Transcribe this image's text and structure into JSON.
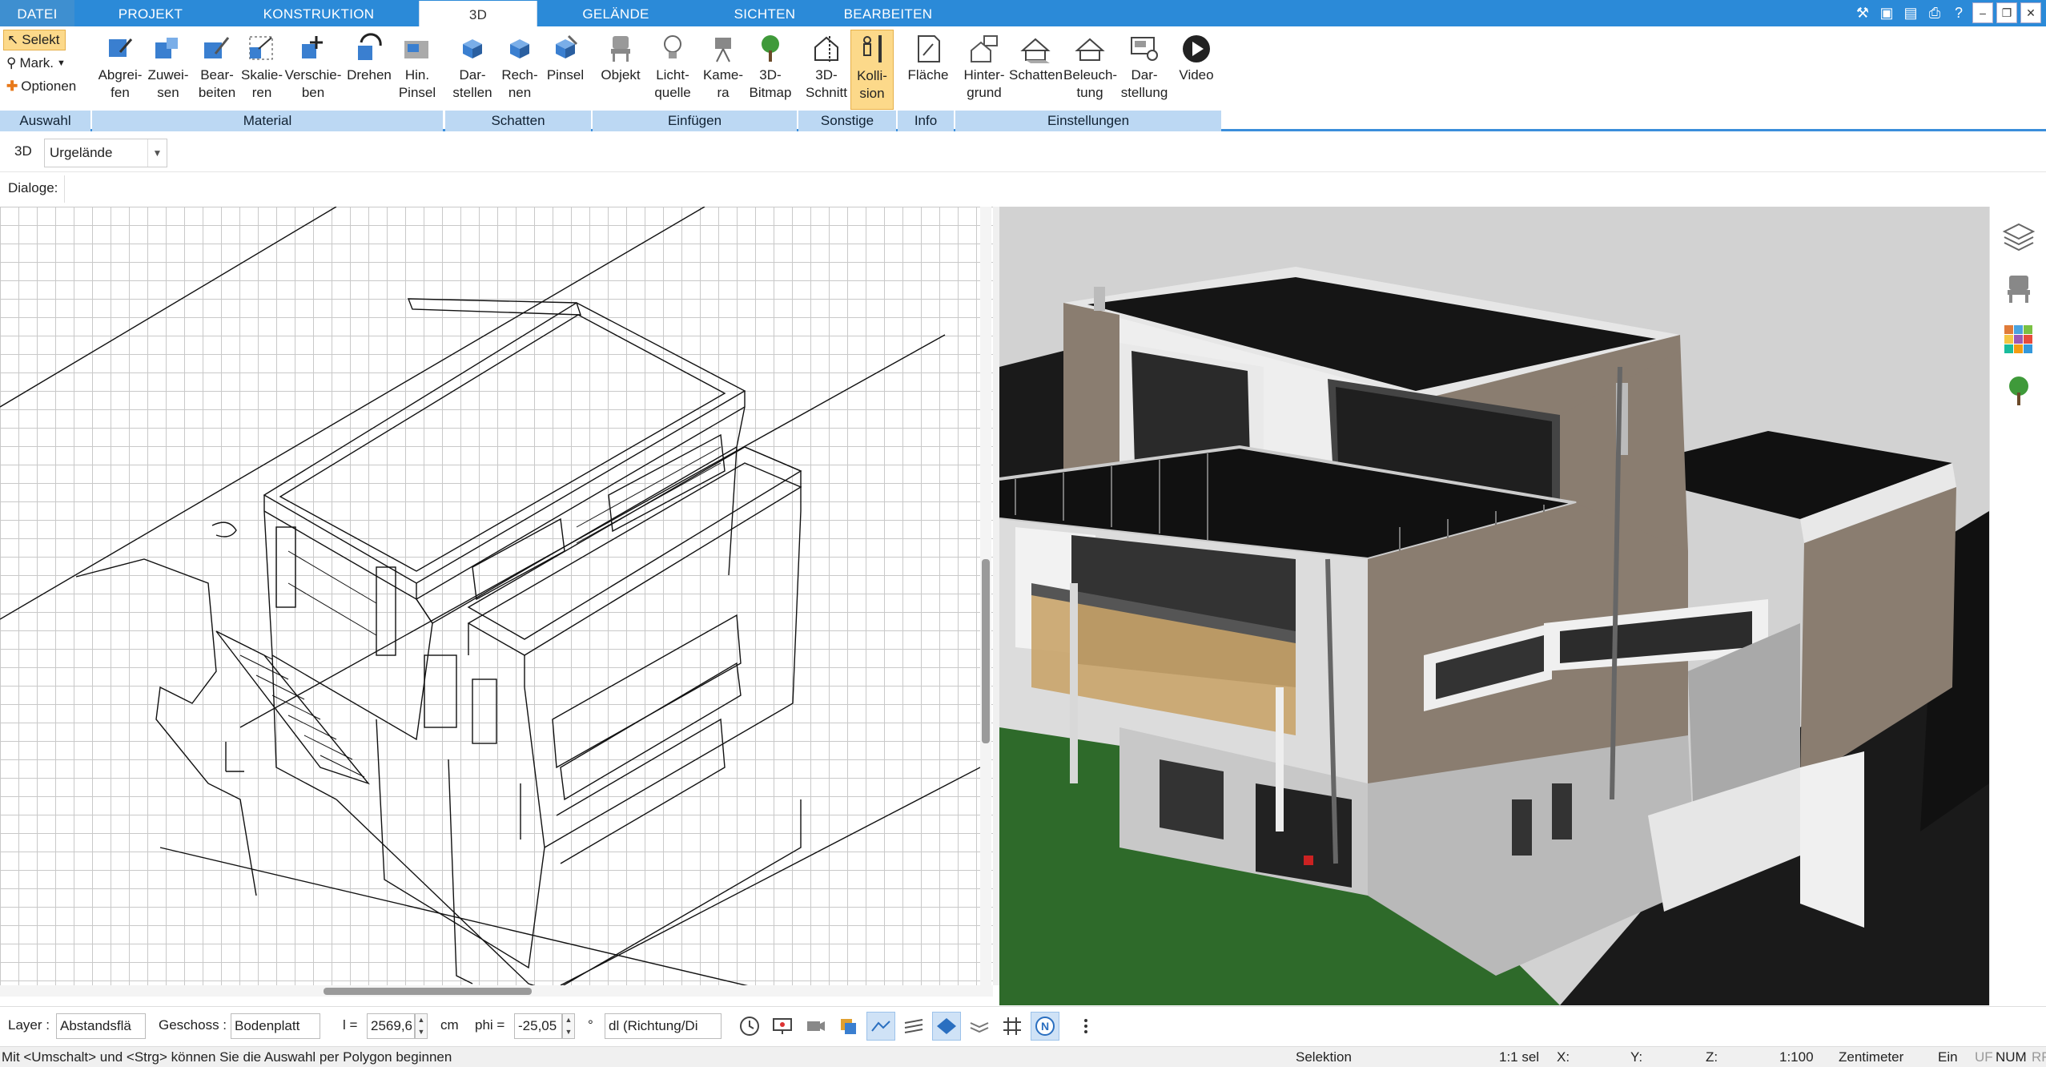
{
  "tabs": [
    {
      "label": "DATEI",
      "kind": "file"
    },
    {
      "label": "PROJEKT"
    },
    {
      "label": "KONSTRUKTION"
    },
    {
      "label": "3D",
      "active": true
    },
    {
      "label": "GELÄNDE"
    },
    {
      "label": "SICHTEN"
    },
    {
      "label": "BEARBEITEN"
    }
  ],
  "ribbon": {
    "selekt": "Selekt",
    "mark": "Mark.",
    "optionen": "Optionen",
    "buttons": [
      {
        "label": "Abgrei-\nfen",
        "icon": "eyedropper-icon"
      },
      {
        "label": "Zuwei-\nsen",
        "icon": "assign-material-icon"
      },
      {
        "label": "Bear-\nbeiten",
        "icon": "edit-material-icon"
      },
      {
        "label": "Skalie-\nren",
        "icon": "scale-icon"
      },
      {
        "label": "Verschie-\nben",
        "icon": "move-icon"
      },
      {
        "label": "Drehen",
        "icon": "rotate-icon"
      },
      {
        "label": "Hin.\nPinsel",
        "icon": "background-brush-icon"
      },
      {
        "label": "Dar-\nstellen",
        "icon": "shadow-display-icon"
      },
      {
        "label": "Rech-\nnen",
        "icon": "shadow-calc-icon"
      },
      {
        "label": "Pinsel",
        "icon": "shadow-brush-icon"
      },
      {
        "label": "Objekt",
        "icon": "chair-icon"
      },
      {
        "label": "Licht-\nquelle",
        "icon": "lightbulb-icon"
      },
      {
        "label": "Kame-\nra",
        "icon": "camera-icon"
      },
      {
        "label": "3D-\nBitmap",
        "icon": "tree-icon"
      },
      {
        "label": "3D-\nSchnitt",
        "icon": "section-icon"
      },
      {
        "label": "Kolli-\nsion",
        "icon": "collision-icon",
        "active": true
      },
      {
        "label": "Fläche",
        "icon": "area-icon"
      },
      {
        "label": "Hinter-\ngrund",
        "icon": "background-icon"
      },
      {
        "label": "Schatten",
        "icon": "shadow-house-icon"
      },
      {
        "label": "Beleuch-\ntung",
        "icon": "lighting-icon"
      },
      {
        "label": "Dar-\nstellung",
        "icon": "display-icon"
      },
      {
        "label": "Video",
        "icon": "video-play-icon"
      }
    ],
    "groups": [
      "Auswahl",
      "Material",
      "Schatten",
      "Einfügen",
      "Sonstige",
      "Info",
      "Einstellungen"
    ]
  },
  "toolbar": {
    "view_label": "3D",
    "view_value": "Urgelände",
    "dialoge": "Dialoge:"
  },
  "bottom": {
    "layer_label": "Layer :",
    "layer_value": "Abstandsflä",
    "geschoss_label": "Geschoss :",
    "geschoss_value": "Bodenplatt",
    "l_label": "l =",
    "l_value": "2569,6",
    "l_unit": "cm",
    "phi_label": "phi =",
    "phi_value": "-25,05",
    "phi_unit": "°",
    "mode_value": "dl (Richtung/Di"
  },
  "status": {
    "message": "Mit <Umschalt> und <Strg> können Sie die Auswahl per Polygon beginnen",
    "mode": "Selektion",
    "sel": "1:1 sel",
    "x": "X:",
    "y": "Y:",
    "z": "Z:",
    "scale": "1:100",
    "unit": "Zentimeter",
    "ein": "Ein",
    "uf": "UF",
    "num": "NUM",
    "rf": "RF"
  },
  "colors": {
    "tabbar": "#2b8ad8",
    "ribbon_group": "#bcd8f3",
    "active_button": "#fcd98a",
    "grass": "#2e6a2a",
    "sky": "#d2d2d2"
  }
}
